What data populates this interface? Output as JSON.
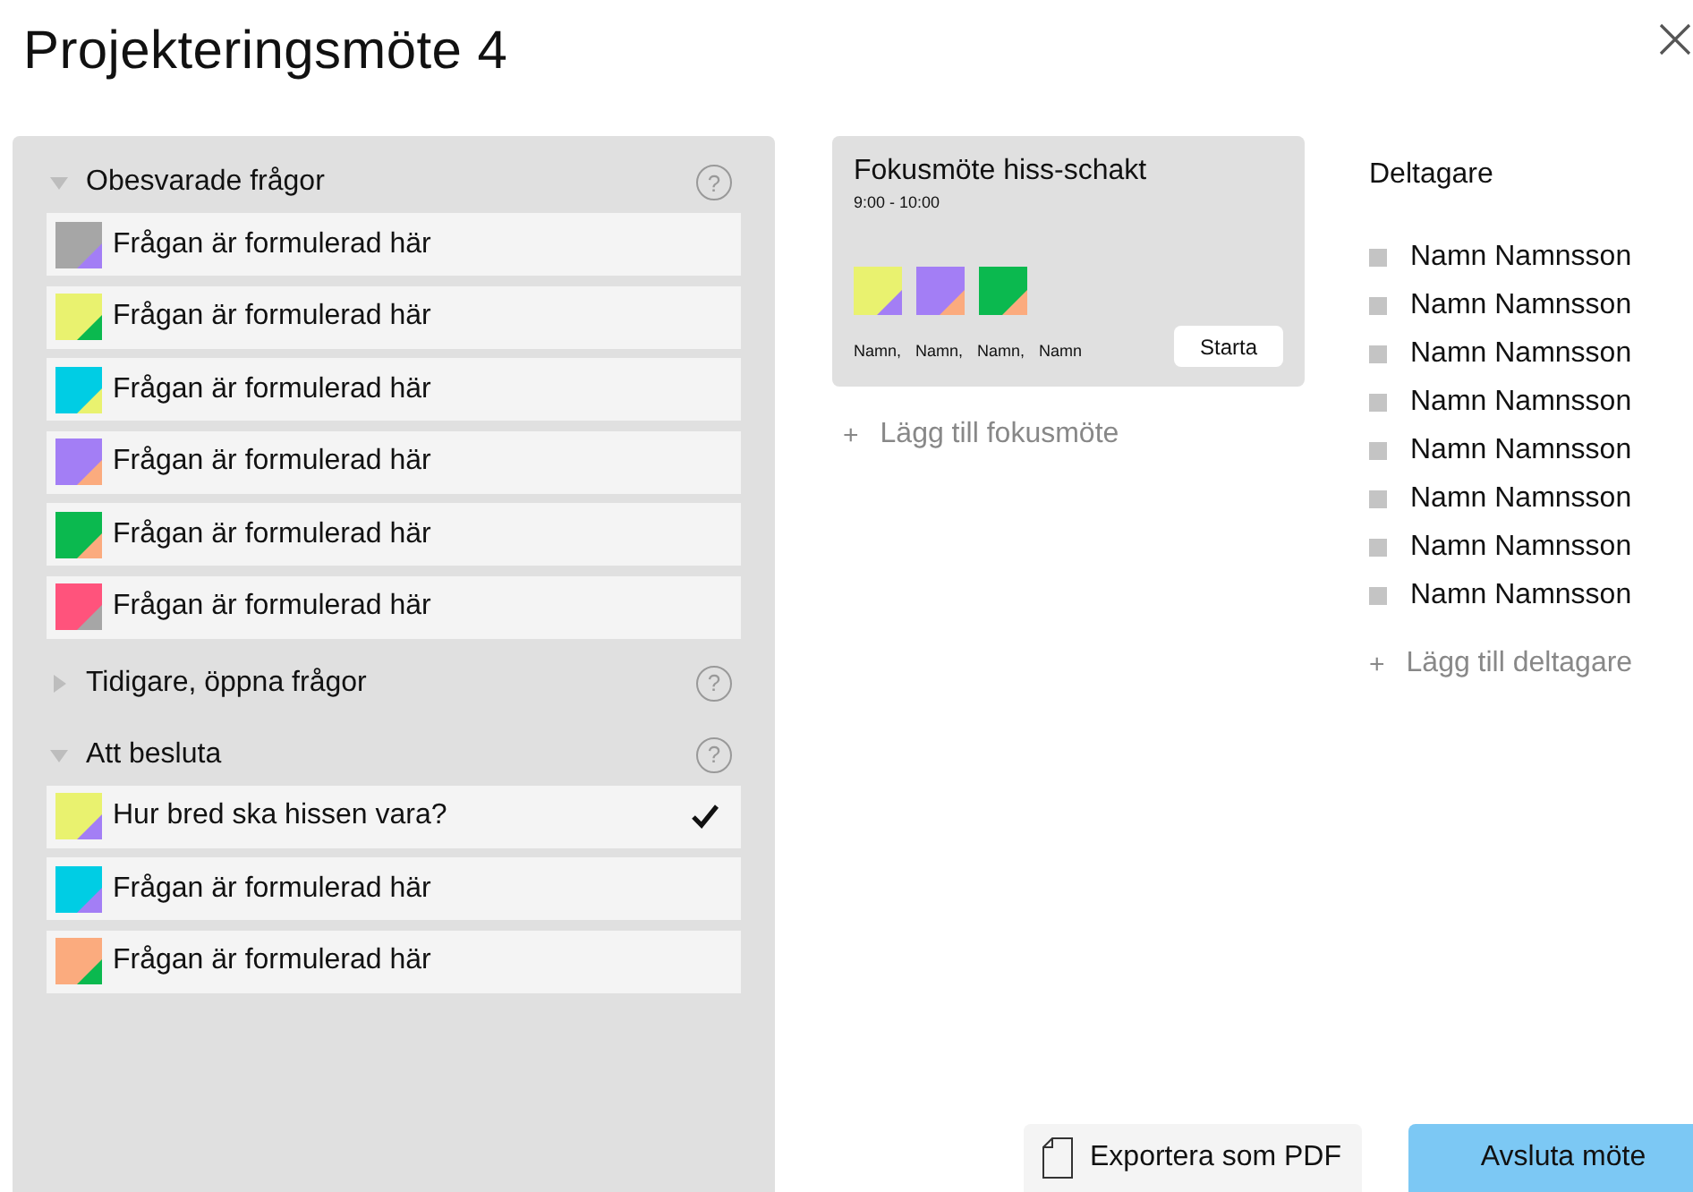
{
  "title": "Projekteringsmöte 4",
  "sections": [
    {
      "label": "Obesvarade frågor",
      "expanded": true,
      "help": "?",
      "questions": [
        {
          "text": "Frågan är formulerad här",
          "color": "#a6a6a6",
          "corner": {
            "color": "#a37ef5"
          },
          "checked": false
        },
        {
          "text": "Frågan är formulerad här",
          "color": "#e9f26f",
          "corner": {
            "color": "#0bb94f"
          },
          "checked": false
        },
        {
          "text": "Frågan är formulerad här",
          "color": "#00cde4",
          "corner": {
            "color": "#e9f26f"
          },
          "checked": false
        },
        {
          "text": "Frågan är formulerad här",
          "color": "#a37ef5",
          "corner": {
            "color": "#fbab7e"
          },
          "checked": false
        },
        {
          "text": "Frågan är formulerad här",
          "color": "#0bb94f",
          "corner": {
            "color": "#fbab7e"
          },
          "checked": false
        },
        {
          "text": "Frågan är formulerad här",
          "color": "#ff537c",
          "corner": {
            "color": "#a6a6a6"
          },
          "checked": false
        }
      ]
    },
    {
      "label": "Tidigare, öppna frågor",
      "expanded": false,
      "help": "?"
    },
    {
      "label": "Att besluta",
      "expanded": true,
      "help": "?",
      "questions": [
        {
          "text": "Hur bred ska hissen vara?",
          "color": "#e9f26f",
          "corner": {
            "color": "#a37ef5"
          },
          "checked": true
        },
        {
          "text": "Frågan är formulerad här",
          "color": "#00cde4",
          "corner": {
            "color": "#a37ef5"
          },
          "checked": false
        },
        {
          "text": "Frågan är formulerad här",
          "color": "#fbab7e",
          "corner": {
            "color": "#0bb94f"
          },
          "checked": false
        }
      ]
    }
  ],
  "focus_meeting": {
    "title": "Fokusmöte hiss-schakt",
    "time": "9:00 - 10:00",
    "swatches": [
      {
        "color": "#e9f26f",
        "corner": {
          "color": "#a37ef5"
        }
      },
      {
        "color": "#a37ef5",
        "corner": {
          "color": "#fbab7e"
        }
      },
      {
        "color": "#0bb94f",
        "corner": {
          "color": "#fbab7e"
        }
      }
    ],
    "names": [
      "Namn,",
      "Namn,",
      "Namn,",
      "Namn"
    ],
    "button": "Starta"
  },
  "add_focus_meeting": {
    "icon": "+",
    "label": "Lägg till fokusmöte"
  },
  "participants": {
    "heading": "Deltagare",
    "names": [
      "Namn Namnsson",
      "Namn Namnsson",
      "Namn Namnsson",
      "Namn Namnsson",
      "Namn Namnsson",
      "Namn Namnsson",
      "Namn Namnsson",
      "Namn Namnsson"
    ]
  },
  "add_participant": {
    "icon": "+",
    "label": "Lägg till deltagare"
  },
  "buttons": {
    "export": "Exportera som PDF",
    "finish": "Avsluta möte"
  }
}
